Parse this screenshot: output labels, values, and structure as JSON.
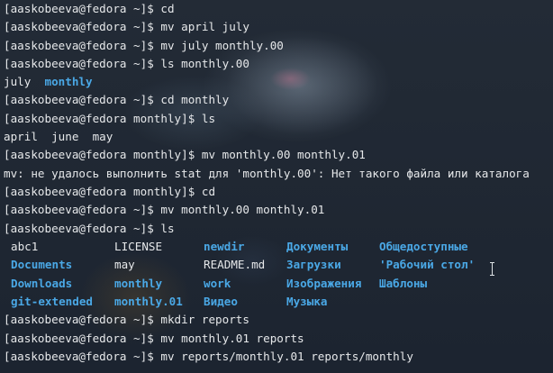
{
  "terminal": {
    "lines_top": [
      {
        "prompt": "[aaskobeeva@fedora ~]$ ",
        "command": "cd"
      },
      {
        "prompt": "[aaskobeeva@fedora ~]$ ",
        "command": "mv april july"
      },
      {
        "prompt": "[aaskobeeva@fedora ~]$ ",
        "command": "mv july monthly.00"
      },
      {
        "prompt": "[aaskobeeva@fedora ~]$ ",
        "command": "ls monthly.00"
      }
    ],
    "ls_monthly00_output": {
      "file": "july",
      "dir": "monthly"
    },
    "lines_mid": [
      {
        "prompt": "[aaskobeeva@fedora ~]$ ",
        "command": "cd monthly"
      },
      {
        "prompt": "[aaskobeeva@fedora monthly]$ ",
        "command": "ls"
      }
    ],
    "ls_monthly_output": "april  june  may",
    "lines_mid2": [
      {
        "prompt": "[aaskobeeva@fedora monthly]$ ",
        "command": "mv monthly.00 monthly.01"
      }
    ],
    "error_message": "mv: не удалось выполнить stat для 'monthly.00': Нет такого файла или каталога",
    "lines_mid3": [
      {
        "prompt": "[aaskobeeva@fedora monthly]$ ",
        "command": "cd"
      },
      {
        "prompt": "[aaskobeeva@fedora ~]$ ",
        "command": "mv monthly.00 monthly.01"
      },
      {
        "prompt": "[aaskobeeva@fedora ~]$ ",
        "command": "ls"
      }
    ],
    "ls_home_rows": [
      [
        {
          "text": "abc1",
          "dir": false
        },
        {
          "text": "LICENSE",
          "dir": false
        },
        {
          "text": "newdir",
          "dir": true
        },
        {
          "text": "Документы",
          "dir": true
        },
        {
          "text": "Общедоступные",
          "dir": true
        }
      ],
      [
        {
          "text": "Documents",
          "dir": true
        },
        {
          "text": "may",
          "dir": false
        },
        {
          "text": "README.md",
          "dir": false
        },
        {
          "text": "Загрузки",
          "dir": true
        },
        {
          "text": "'Рабочий стол'",
          "dir": true
        }
      ],
      [
        {
          "text": "Downloads",
          "dir": true
        },
        {
          "text": "monthly",
          "dir": true
        },
        {
          "text": "work",
          "dir": true
        },
        {
          "text": "Изображения",
          "dir": true
        },
        {
          "text": "Шаблоны",
          "dir": true
        }
      ],
      [
        {
          "text": "git-extended",
          "dir": true
        },
        {
          "text": "monthly.01",
          "dir": true
        },
        {
          "text": "Видео",
          "dir": true
        },
        {
          "text": "Музыка",
          "dir": true
        },
        {
          "text": "",
          "dir": false
        }
      ]
    ],
    "lines_bottom": [
      {
        "prompt": "[aaskobeeva@fedora ~]$ ",
        "command": "mkdir reports"
      },
      {
        "prompt": "[aaskobeeva@fedora ~]$ ",
        "command": "mv monthly.01 reports"
      },
      {
        "prompt": "[aaskobeeva@fedora ~]$ ",
        "command": "mv reports/monthly.01 reports/monthly"
      }
    ]
  },
  "colors": {
    "background": "#1e2631",
    "text": "#e6e8ea",
    "directory": "#4aa8e6"
  },
  "icons": {
    "mouse_cursor": "ibeam-cursor-icon"
  }
}
